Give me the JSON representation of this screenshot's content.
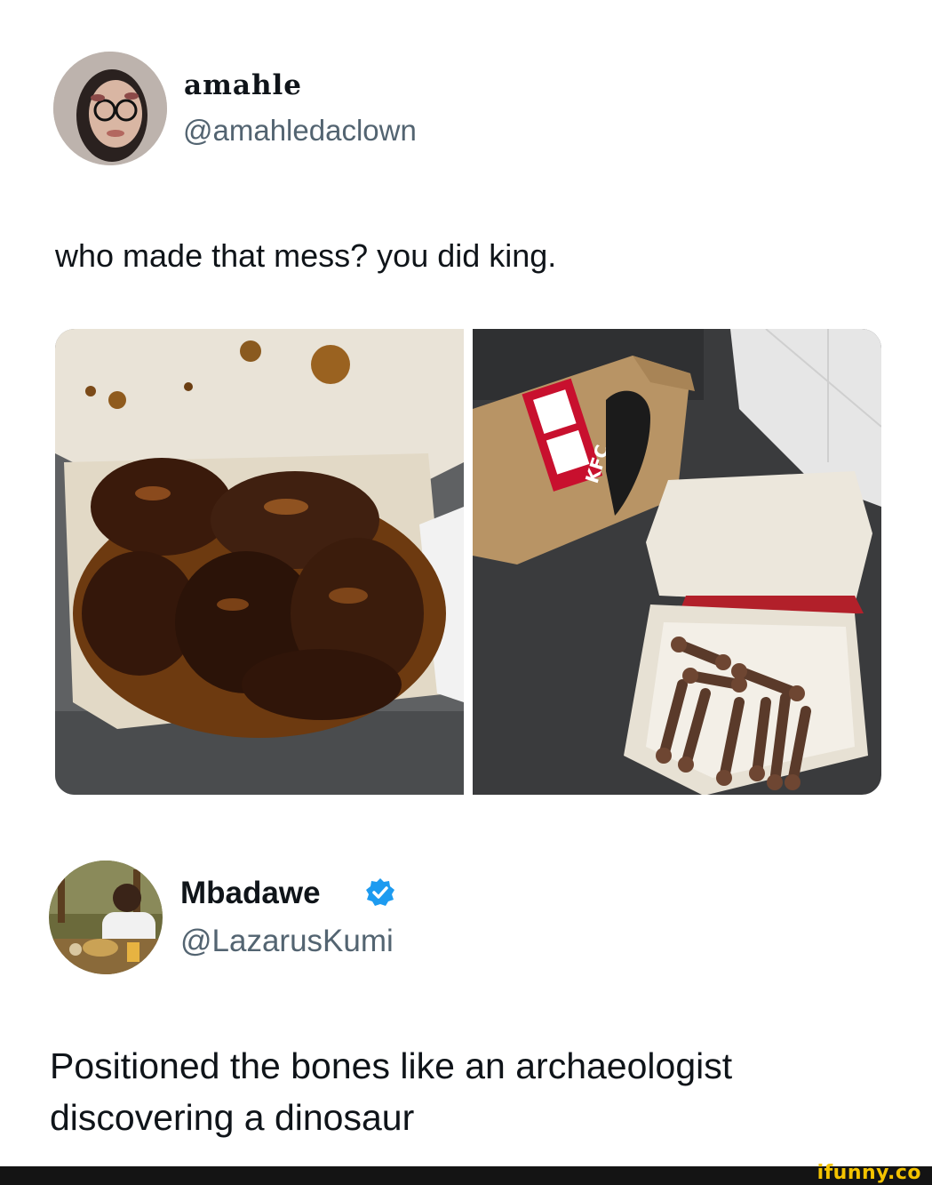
{
  "tweet": {
    "author_name": "amahle",
    "author_handle": "@amahledaclown",
    "text": "who made that mess? you did king.",
    "images": [
      {
        "icon": "saucy-chicken-wings-photo"
      },
      {
        "icon": "kfc-bag-and-bones-photo",
        "bag_label": "KFC"
      }
    ]
  },
  "reply": {
    "author_name": "Mbadawe",
    "author_handle": "@LazarusKumi",
    "verified_icon": "verified-badge-icon",
    "text_line1": "Positioned the bones like an archaeologist",
    "text_line2": "discovering a dinosaur"
  },
  "footer": {
    "watermark": "ifunny.co"
  },
  "colors": {
    "text": "#0f1419",
    "handle": "#536471",
    "verified": "#1d9bf0",
    "watermark": "#f4c300"
  }
}
